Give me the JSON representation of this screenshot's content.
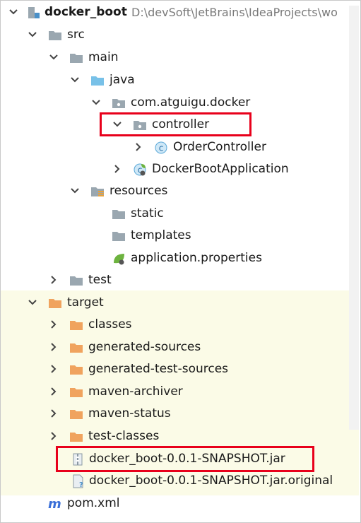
{
  "tree": {
    "root": {
      "name": "docker_boot",
      "path": "D:\\devSoft\\JetBrains\\IdeaProjects\\wo"
    },
    "src": "src",
    "main": "main",
    "java": "java",
    "package": "com.atguigu.docker",
    "controller": "controller",
    "order_controller": "OrderController",
    "app_class": "DockerBootApplication",
    "resources": "resources",
    "static": "static",
    "templates": "templates",
    "properties": "application.properties",
    "test": "test",
    "target": "target",
    "classes": "classes",
    "generated_sources": "generated-sources",
    "generated_test_sources": "generated-test-sources",
    "maven_archiver": "maven-archiver",
    "maven_status": "maven-status",
    "test_classes": "test-classes",
    "jar": "docker_boot-0.0.1-SNAPSHOT.jar",
    "jar_original": "docker_boot-0.0.1-SNAPSHOT.jar.original",
    "pom": "pom.xml"
  },
  "colors": {
    "folder_gray": "#9aa7b0",
    "folder_blue": "#78c1e8",
    "folder_orange": "#f0a35e",
    "highlight_red": "#e8001b",
    "excluded_band": "#fbfbe7"
  },
  "icons": [
    "module-icon",
    "folder-icon",
    "source-folder-icon",
    "package-icon",
    "class-icon",
    "spring-boot-class-icon",
    "resources-folder-icon",
    "spring-properties-icon",
    "excluded-folder-icon",
    "jar-icon",
    "unknown-file-icon",
    "maven-icon"
  ]
}
